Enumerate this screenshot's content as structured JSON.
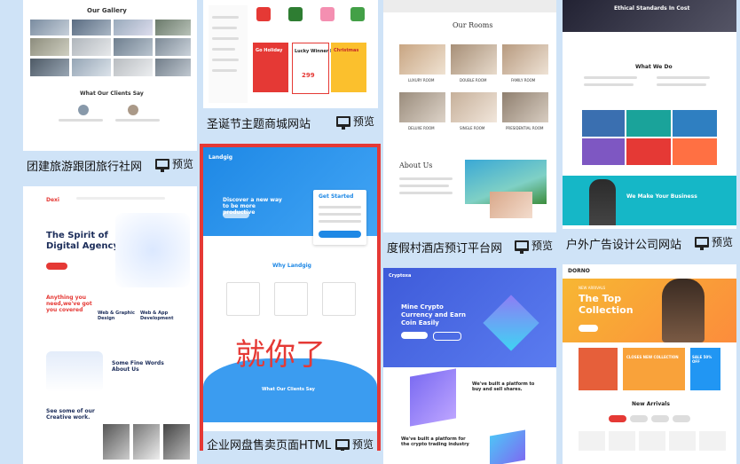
{
  "cards": {
    "travel": {
      "caption": "团建旅游跟团旅行社网",
      "gallery_title": "Our Gallery",
      "clients_title": "What Our Clients Say"
    },
    "xmas": {
      "caption": "圣诞节主题商城网站",
      "promo1": "Go Holiday",
      "promo2": "Lucky Winner Box",
      "promo3": "Christmas",
      "price": "299"
    },
    "resort": {
      "caption": "度假村酒店预订平台网",
      "rooms_title": "Our Rooms",
      "about_title": "About Us",
      "rooms": [
        "LUXURY ROOM",
        "DOUBLE ROOM",
        "FAMILY ROOM",
        "DELUXE ROOM",
        "SINGLE ROOM",
        "PRESIDENTIAL ROOM"
      ]
    },
    "ads": {
      "caption": "户外广告设计公司网站",
      "hero_title": "Ethical Standards In Cost",
      "whatwedo": "What We Do",
      "business": "We Make Your Business"
    },
    "agency": {
      "hero_title": "The Spirit of Digital Agency.",
      "need": "Anything you need,we've got you covered",
      "words": "Some Fine Words About Us",
      "creative": "See some of our Creative work.",
      "feat1": "Web & Graphic Design",
      "feat2": "Web & App Development"
    },
    "landgig": {
      "caption": "企业网盘售卖页面HTML",
      "logo": "Landgig",
      "hero": "Discover a new way to be more productive",
      "form_title": "Get Started",
      "why": "Why Landgig",
      "clients": "What Our Clients Say",
      "overlay": "就你了"
    },
    "crypto": {
      "logo": "Cryptoxa",
      "hero": "Mine Crypto Currency and Earn Coin Easily",
      "block1": "We've built a platform to buy and sell shares.",
      "block2": "We've built a platform for the crypto trading industry"
    },
    "shoes": {
      "logo": "DORNO",
      "hero": "The Top Collection",
      "sub": "NEW ARRIVALS",
      "collection": "CLOSES NEW COLLECTION",
      "sale": "SALE 50% OFF",
      "arrivals": "New Arrivals"
    },
    "preview_label": "预览"
  }
}
